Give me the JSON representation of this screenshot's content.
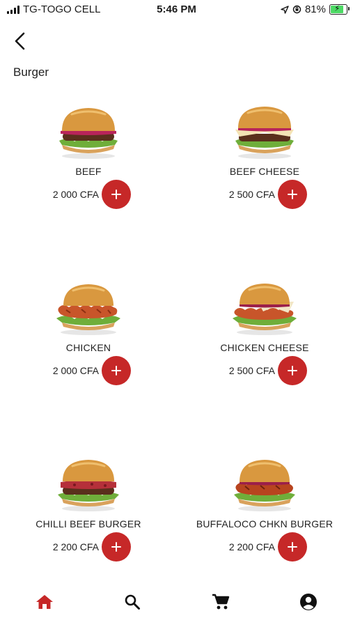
{
  "status_bar": {
    "carrier": "TG-TOGO CELL",
    "time": "5:46 PM",
    "battery": "81%",
    "battery_level": 0.81,
    "icons": [
      "signal-icon",
      "location-icon",
      "orientation-lock-icon",
      "battery-icon"
    ]
  },
  "header": {
    "back_icon": "chevron-left-icon",
    "title": "Burger"
  },
  "colors": {
    "accent": "#c62828",
    "active_nav": "#c62828",
    "inactive_nav": "#111111"
  },
  "products": [
    {
      "name": "BEEF",
      "price": "2 000  CFA",
      "add_label": "+"
    },
    {
      "name": "BEEF CHEESE",
      "price": "2 500  CFA",
      "add_label": "+"
    },
    {
      "name": "CHICKEN",
      "price": "2 000  CFA",
      "add_label": "+"
    },
    {
      "name": "CHICKEN CHEESE",
      "price": "2 500  CFA",
      "add_label": "+"
    },
    {
      "name": "CHILLI BEEF BURGER",
      "price": "2 200  CFA",
      "add_label": "+"
    },
    {
      "name": "BUFFALOCO CHKN BURGER",
      "price": "2 200  CFA",
      "add_label": "+"
    }
  ],
  "bottom_nav": {
    "items": [
      {
        "icon": "home-icon",
        "active": true
      },
      {
        "icon": "search-icon",
        "active": false
      },
      {
        "icon": "cart-icon",
        "active": false
      },
      {
        "icon": "account-icon",
        "active": false
      }
    ]
  }
}
